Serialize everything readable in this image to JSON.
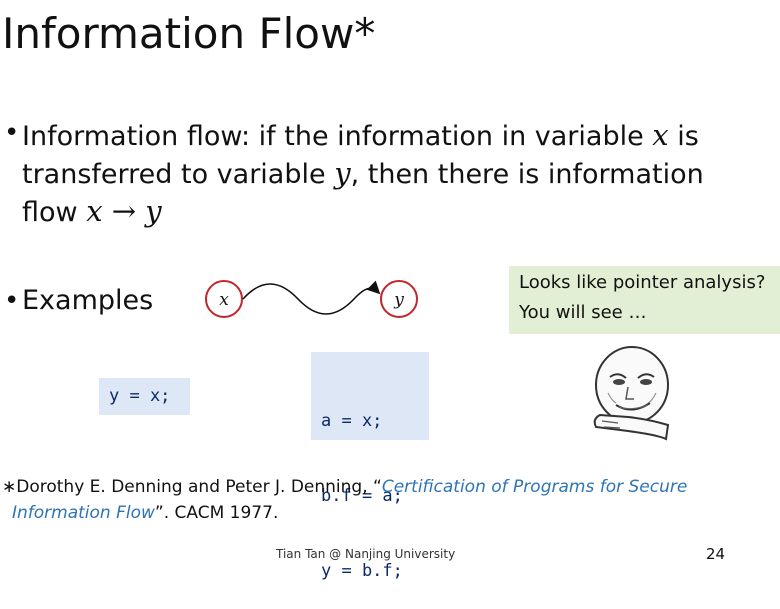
{
  "slide": {
    "title": "Information Flow*",
    "bullet1": {
      "line1_pre": "Information flow: if the information in variable ",
      "line1_var": "x",
      "line1_post": " is",
      "line2_pre": "transferred to variable ",
      "line2_var": "y",
      "line2_post": ", then there is information",
      "line3_pre": "flow ",
      "line3_expr": "x → y"
    },
    "bullet2": {
      "label": "Examples"
    },
    "diagram": {
      "source": "x",
      "target": "y"
    },
    "code1": "y = x;",
    "code2": [
      "a = x;",
      "b.f = a;",
      "y = b.f;"
    ],
    "callout": {
      "line1": "Looks like pointer analysis?",
      "line2": "You will see …"
    },
    "footnote": {
      "marker": "∗",
      "authors": "Dorothy E. Denning and Peter J. Denning, “",
      "title_part1": "Certification of Programs for Secure",
      "title_part2": "Information Flow",
      "tail": "”. CACM 1977."
    },
    "footer": "Tian Tan @ Nanjing University",
    "page_number": "24",
    "colors": {
      "code_bg": "#dde7f5",
      "callout_bg": "#e2efd4",
      "node_stroke": "#c0282d",
      "citation": "#2e74b5"
    }
  }
}
